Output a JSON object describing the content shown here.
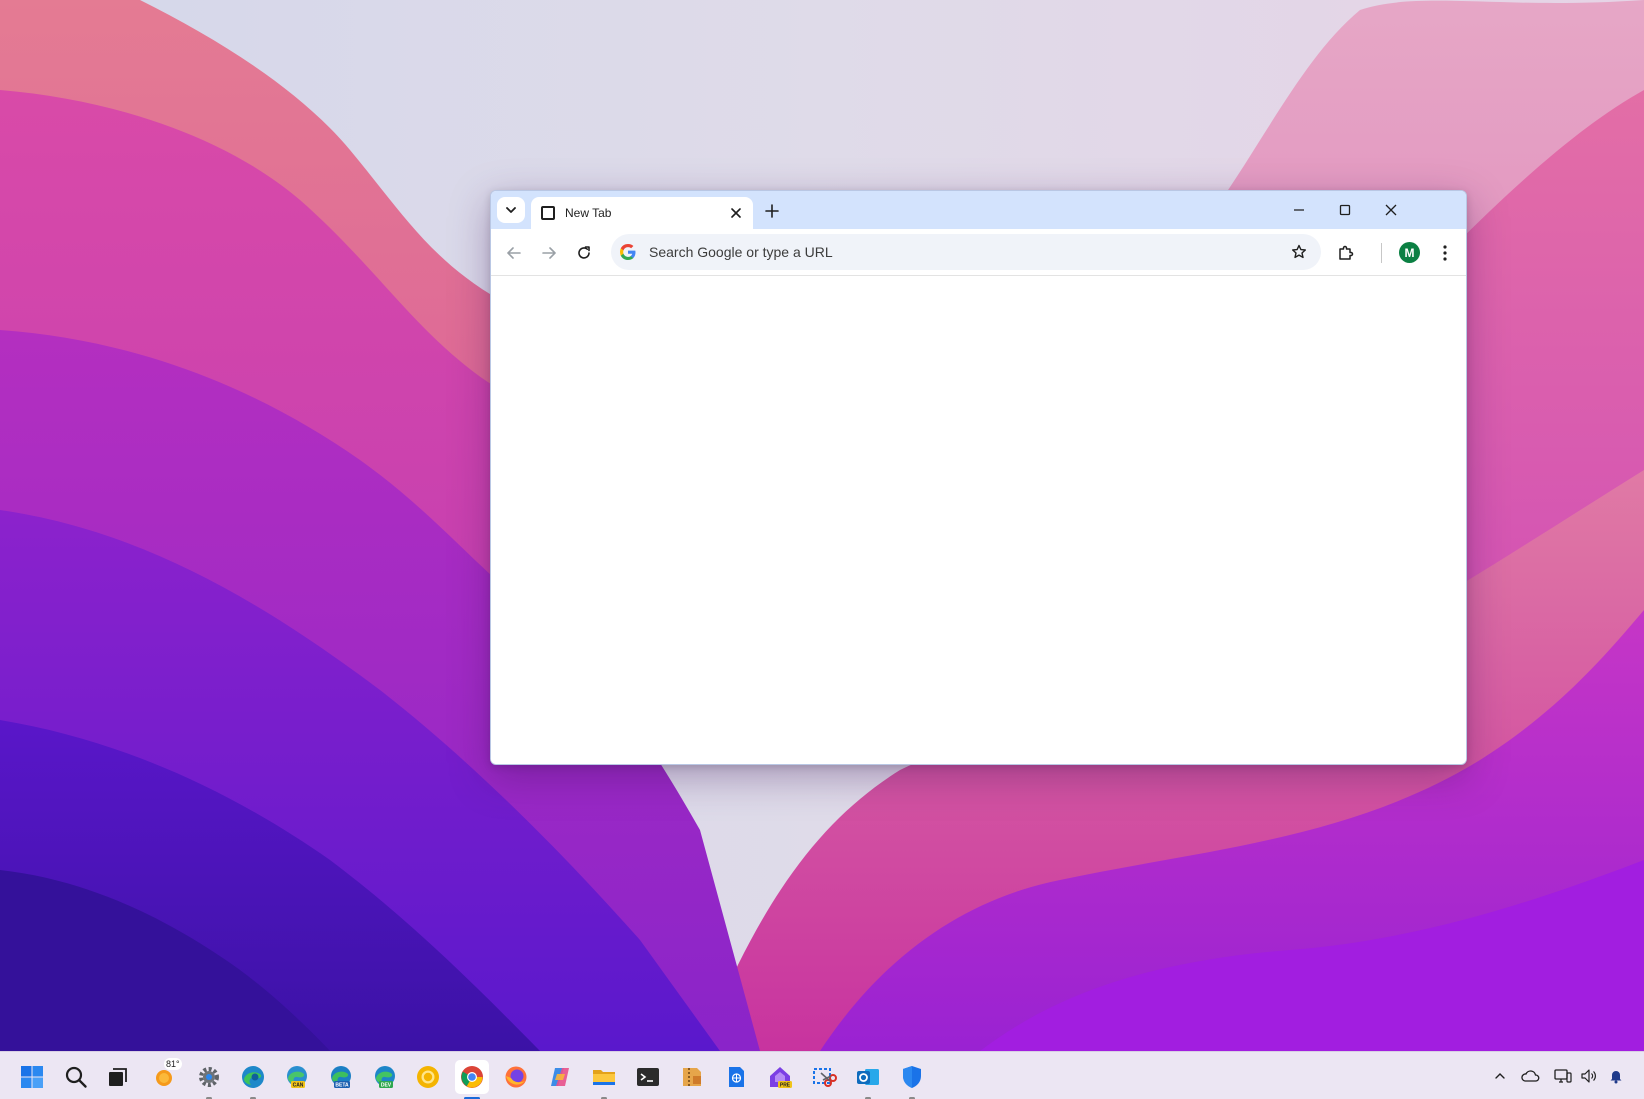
{
  "browser": {
    "tab": {
      "title": "New Tab"
    },
    "omnibox": {
      "placeholder": "Search Google or type a URL"
    },
    "profile": {
      "initial": "M",
      "color": "#0b8043"
    }
  },
  "taskbar": {
    "weather": {
      "temperature": "81°"
    },
    "pinned": [
      {
        "name": "start",
        "icon": "windows-logo-icon"
      },
      {
        "name": "search",
        "icon": "search-icon"
      },
      {
        "name": "task-view",
        "icon": "task-view-icon"
      },
      {
        "name": "weather",
        "icon": "weather-sun-icon"
      },
      {
        "name": "settings",
        "icon": "gear-icon"
      },
      {
        "name": "edge",
        "icon": "edge-icon",
        "running": true
      },
      {
        "name": "edge-canary",
        "icon": "edge-canary-icon",
        "badge": "CAN"
      },
      {
        "name": "edge-beta",
        "icon": "edge-beta-icon",
        "badge": "BETA"
      },
      {
        "name": "edge-dev",
        "icon": "edge-dev-icon",
        "badge": "DEV"
      },
      {
        "name": "chrome-canary",
        "icon": "chrome-canary-icon"
      },
      {
        "name": "chrome",
        "icon": "chrome-icon",
        "running": true,
        "active": true
      },
      {
        "name": "firefox",
        "icon": "firefox-icon"
      },
      {
        "name": "copilot",
        "icon": "copilot-icon"
      },
      {
        "name": "file-explorer",
        "icon": "folder-icon",
        "running": true
      },
      {
        "name": "terminal",
        "icon": "terminal-icon"
      },
      {
        "name": "archive",
        "icon": "archive-icon"
      },
      {
        "name": "notepad",
        "icon": "notepad-icon"
      },
      {
        "name": "dev-home-preview",
        "icon": "dev-home-icon",
        "badge": "PRE"
      },
      {
        "name": "snipping-tool",
        "icon": "snipping-tool-icon"
      },
      {
        "name": "outlook",
        "icon": "outlook-icon",
        "running": true
      },
      {
        "name": "defender",
        "icon": "shield-icon",
        "running": true
      }
    ],
    "tray": [
      {
        "name": "show-hidden",
        "icon": "chevron-up-icon"
      },
      {
        "name": "onedrive",
        "icon": "cloud-icon"
      },
      {
        "name": "network",
        "icon": "network-icon"
      },
      {
        "name": "volume",
        "icon": "speaker-icon"
      },
      {
        "name": "notifications",
        "icon": "bell-icon"
      }
    ]
  },
  "colors": {
    "tabstrip": "#d3e3fd",
    "omnibox": "#f0f3f9",
    "taskbar": "#ece6f3",
    "accent": "#1a6ad9"
  }
}
